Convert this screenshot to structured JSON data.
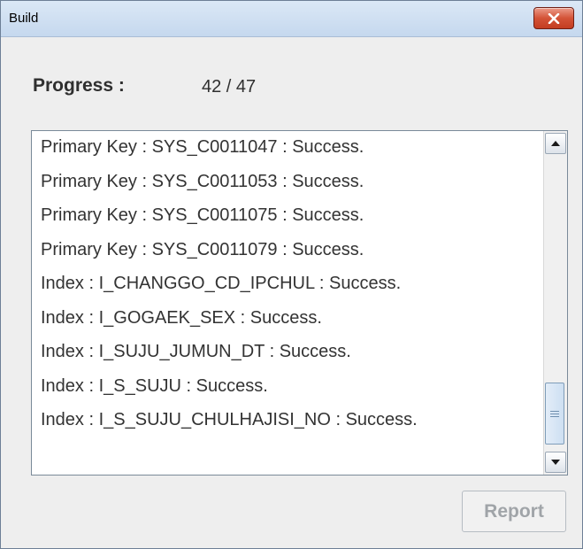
{
  "window": {
    "title": "Build",
    "close_icon": "close-icon",
    "close_color": "#d45337"
  },
  "progress": {
    "label": "Progress :",
    "value": "42 / 47",
    "current": 42,
    "total": 47
  },
  "log": {
    "lines": [
      "Primary Key : SYS_C0011047 : Success.",
      "Primary Key : SYS_C0011053 : Success.",
      "Primary Key : SYS_C0011075 : Success.",
      "Primary Key : SYS_C0011079 : Success.",
      "Index : I_CHANGGO_CD_IPCHUL : Success.",
      "Index : I_GOGAEK_SEX : Success.",
      "Index : I_SUJU_JUMUN_DT : Success.",
      "Index : I_S_SUJU : Success.",
      "Index : I_S_SUJU_CHULHAJISI_NO : Success."
    ],
    "scroll_up_icon": "arrow-up-icon",
    "scroll_down_icon": "arrow-down-icon"
  },
  "actions": {
    "report_label": "Report",
    "report_enabled": false
  }
}
